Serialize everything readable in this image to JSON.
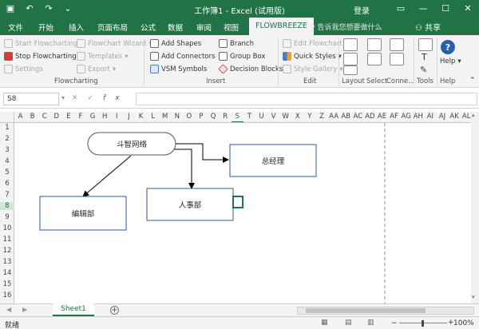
{
  "titlebar": {
    "title": "工作簿1 - Excel (试用版)",
    "login": "登录",
    "qat": [
      "save-icon",
      "undo-icon",
      "redo-icon",
      "customize-icon"
    ],
    "controls": [
      "ribbon-options-icon",
      "minimize-icon",
      "maximize-icon",
      "close-icon"
    ]
  },
  "tabs": {
    "items": [
      "文件",
      "开始",
      "插入",
      "页面布局",
      "公式",
      "数据",
      "审阅",
      "视图",
      "FLOWBREEZE"
    ],
    "active": "FLOWBREEZE",
    "tellme": "告诉我您想要做什么",
    "share": "共享"
  },
  "ribbon": {
    "flowcharting": {
      "start": "Start Flowcharting",
      "stop": "Stop Flowcharting",
      "settings": "Settings",
      "flowchart_wizard": "Flowchart Wizard",
      "templates": "Templates",
      "export": "Export",
      "group": "Flowcharting"
    },
    "insert": {
      "add_shapes": "Add Shapes",
      "add_connectors": "Add Connectors",
      "vsm_symbols": "VSM Symbols",
      "branch": "Branch",
      "group_box": "Group Box",
      "decision_blocks": "Decision Blocks",
      "group": "Insert"
    },
    "edit": {
      "edit_flowchart": "Edit Flowchart",
      "quick_styles": "Quick Styles",
      "style_gallery": "Style Gallery",
      "group": "Edit"
    },
    "right": {
      "layout": "Layout",
      "select": "Select",
      "connectors": "Conne...",
      "tools": "Tools",
      "help": "Help",
      "help_btn": "Help"
    }
  },
  "formula_bar": {
    "name_box": "S8",
    "fx": "fx",
    "value": ""
  },
  "grid": {
    "columns": [
      "A",
      "B",
      "C",
      "D",
      "E",
      "F",
      "G",
      "H",
      "I",
      "J",
      "K",
      "L",
      "M",
      "N",
      "O",
      "P",
      "Q",
      "R",
      "S",
      "T",
      "U",
      "V",
      "W",
      "X",
      "Y",
      "Z",
      "AA",
      "AB",
      "AC",
      "AD",
      "AE",
      "AF",
      "AG",
      "AH",
      "AI",
      "AJ",
      "AK",
      "AL"
    ],
    "rows": [
      "1",
      "2",
      "3",
      "4",
      "5",
      "6",
      "7",
      "8",
      "9",
      "10",
      "11",
      "12",
      "13",
      "14",
      "15",
      "16"
    ],
    "selected_column": "S",
    "selected_row": "8"
  },
  "shapes": {
    "terminal": "斗智网络",
    "manager": "总经理",
    "hr": "人事部",
    "editor": "编辑部"
  },
  "sheets": {
    "tabs": [
      "Sheet1"
    ],
    "active": "Sheet1"
  },
  "status": {
    "text": "就绪",
    "zoom": "100%"
  },
  "colors": {
    "brand": "#217346",
    "shape_border": "#2e5a96",
    "connector": "#000000",
    "selection": "#217346"
  }
}
